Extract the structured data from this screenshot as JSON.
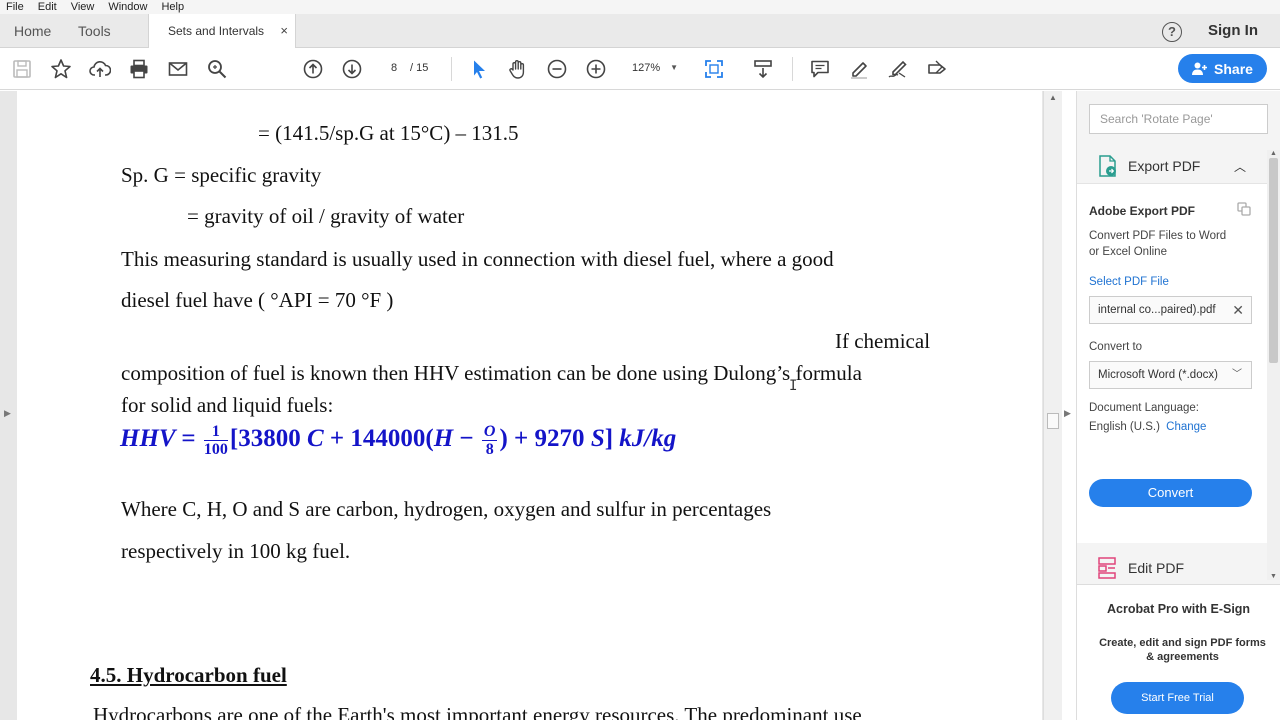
{
  "menu": [
    "File",
    "Edit",
    "View",
    "Window",
    "Help"
  ],
  "tabs": {
    "home": "Home",
    "tools": "Tools",
    "document": "Sets and Intervals",
    "close": "×"
  },
  "header": {
    "help": "?",
    "sign_in": "Sign In"
  },
  "toolbar": {
    "page_current": "8",
    "page_total": "/ 15",
    "zoom": "127%",
    "share": "Share"
  },
  "document": {
    "line1": "= (141.5/sp.G at 15°C) – 131.5",
    "line2": "Sp. G = specific gravity",
    "line3": "= gravity of oil / gravity of water",
    "line4": "This measuring standard is usually used in connection with diesel fuel, where a good",
    "line5": "diesel fuel  have ( °API  = 70 °F )",
    "line6": "If chemical",
    "line7": "composition of fuel is known then HHV estimation can be done using Dulong’s formula",
    "line8": "for solid and liquid fuels:",
    "formula": {
      "lhs": "HHV",
      "eq": "=",
      "frac1_num": "1",
      "frac1_den": "100",
      "open": "[33800",
      "c": "C",
      "plus1": "+ 144000(",
      "h": "H",
      "minus": "−",
      "frac2_num": "O",
      "frac2_den": "8",
      "plus2": ") + 9270",
      "s": "S",
      "close": "]",
      "units": "kJ/kg"
    },
    "line9": "Where C, H, O and S are carbon, hydrogen, oxygen and sulfur  in percentages",
    "line10": "respectively in  100 kg fuel.",
    "heading": "4.5. Hydrocarbon fuel   ",
    "line11": " Hydrocarbons are one of the Earth's most important energy resources. The predominant use"
  },
  "right_pane": {
    "search_placeholder": "Search 'Rotate Page'",
    "export_pdf": "Export PDF",
    "adobe_export_title": "Adobe Export PDF",
    "adobe_export_desc": "Convert PDF Files to Word or Excel Online",
    "select_file": "Select PDF File",
    "file_name": "internal co...paired).pdf",
    "convert_to": "Convert to",
    "convert_format": "Microsoft Word (*.docx)",
    "doc_language": "Document Language:",
    "language": "English (U.S.)",
    "change": "Change",
    "convert": "Convert",
    "edit_pdf": "Edit PDF",
    "promo_title": "Acrobat Pro with E-Sign",
    "promo_desc": "Create, edit and sign PDF forms & agreements",
    "trial": "Start Free Trial"
  },
  "colors": {
    "accent": "#2680eb",
    "formula": "#1414c8",
    "link": "#2073d2"
  }
}
